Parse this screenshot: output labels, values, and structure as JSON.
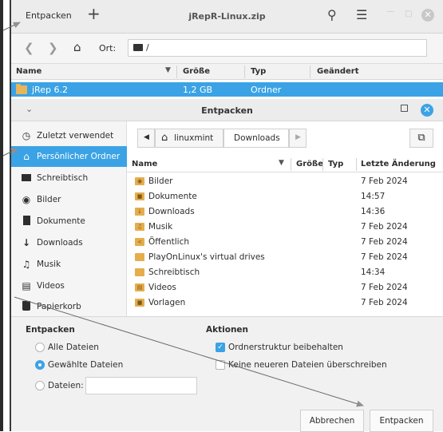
{
  "back_window": {
    "extract_label": "Entpacken",
    "plus": "+",
    "title": "jRepR-Linux.zip",
    "location_label": "Ort:",
    "location_path": "/",
    "columns": [
      "Name",
      "Größe",
      "Typ",
      "Geändert"
    ],
    "rows": [
      {
        "name": "jRep 6.2",
        "size": "1,2 GB",
        "type": "Ordner",
        "modified": ""
      }
    ]
  },
  "dialog": {
    "title": "Entpacken",
    "sidebar": [
      {
        "label": "Zuletzt verwendet",
        "icon": "clock-icon"
      },
      {
        "label": "Persönlicher Ordner",
        "icon": "home-icon"
      },
      {
        "label": "Schreibtisch",
        "icon": "desktop-icon"
      },
      {
        "label": "Bilder",
        "icon": "camera-icon"
      },
      {
        "label": "Dokumente",
        "icon": "document-icon"
      },
      {
        "label": "Downloads",
        "icon": "download-icon"
      },
      {
        "label": "Musik",
        "icon": "music-icon"
      },
      {
        "label": "Videos",
        "icon": "film-icon"
      },
      {
        "label": "Papierkorb",
        "icon": "trash-icon"
      }
    ],
    "path": [
      "linuxmint",
      "Downloads"
    ],
    "columns": [
      "Name",
      "Größe",
      "Typ",
      "Letzte Änderung"
    ],
    "files": [
      {
        "name": "Bilder",
        "date": "7 Feb 2024",
        "icon": "pictures-folder-icon"
      },
      {
        "name": "Dokumente",
        "date": "14:57",
        "icon": "documents-folder-icon"
      },
      {
        "name": "Downloads",
        "date": "14:36",
        "icon": "downloads-folder-icon"
      },
      {
        "name": "Musik",
        "date": "7 Feb 2024",
        "icon": "music-folder-icon"
      },
      {
        "name": "Öffentlich",
        "date": "7 Feb 2024",
        "icon": "public-folder-icon"
      },
      {
        "name": "PlayOnLinux's virtual drives",
        "date": "7 Feb 2024",
        "icon": "folder-icon"
      },
      {
        "name": "Schreibtisch",
        "date": "14:34",
        "icon": "folder-icon"
      },
      {
        "name": "Videos",
        "date": "7 Feb 2024",
        "icon": "videos-folder-icon"
      },
      {
        "name": "Vorlagen",
        "date": "7 Feb 2024",
        "icon": "templates-folder-icon"
      }
    ],
    "extract_section": {
      "title": "Entpacken",
      "all_files": "Alle Dateien",
      "selected_files": "Gewählte Dateien",
      "files_label": "Dateien:",
      "files_value": ""
    },
    "actions_section": {
      "title": "Aktionen",
      "keep_structure": "Ordnerstruktur beibehalten",
      "no_overwrite": "Keine neueren Dateien überschreiben"
    },
    "cancel_label": "Abbrechen",
    "extract_button_label": "Entpacken"
  },
  "colors": {
    "accent": "#3ba3e5",
    "folder": "#e5ad4c"
  }
}
